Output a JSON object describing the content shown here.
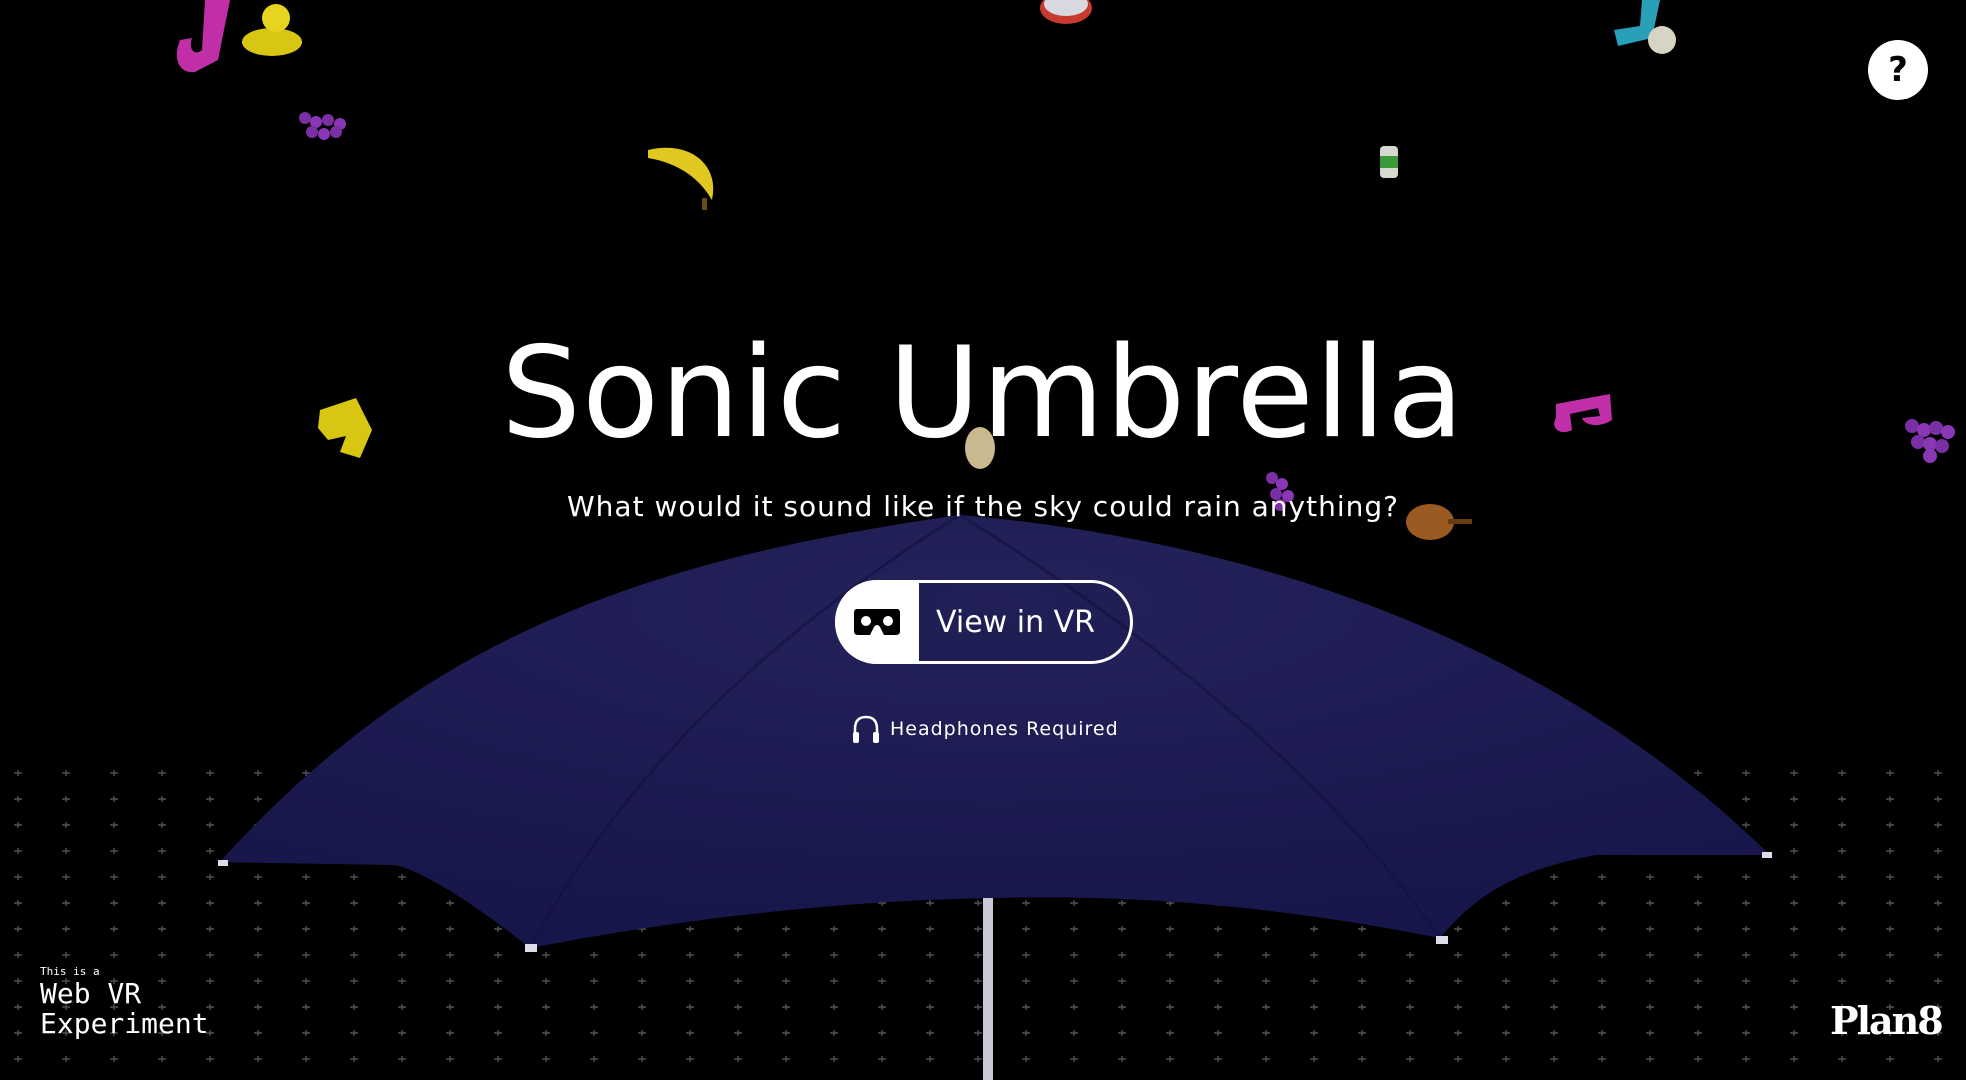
{
  "help": {
    "label": "?"
  },
  "hero": {
    "title": "Sonic Umbrella",
    "subtitle": "What would it sound like if the sky could rain anything?"
  },
  "vr_button": {
    "label": "View in VR",
    "icon": "vr-headset-icon"
  },
  "headphones": {
    "label": "Headphones Required",
    "icon": "headphones-icon"
  },
  "badge": {
    "small": "This is a",
    "line1": "Web VR",
    "line2": "Experiment"
  },
  "logo": {
    "text": "Plan8"
  },
  "colors": {
    "background": "#000000",
    "umbrella": "#1c1a4e",
    "foreground": "#ffffff"
  }
}
